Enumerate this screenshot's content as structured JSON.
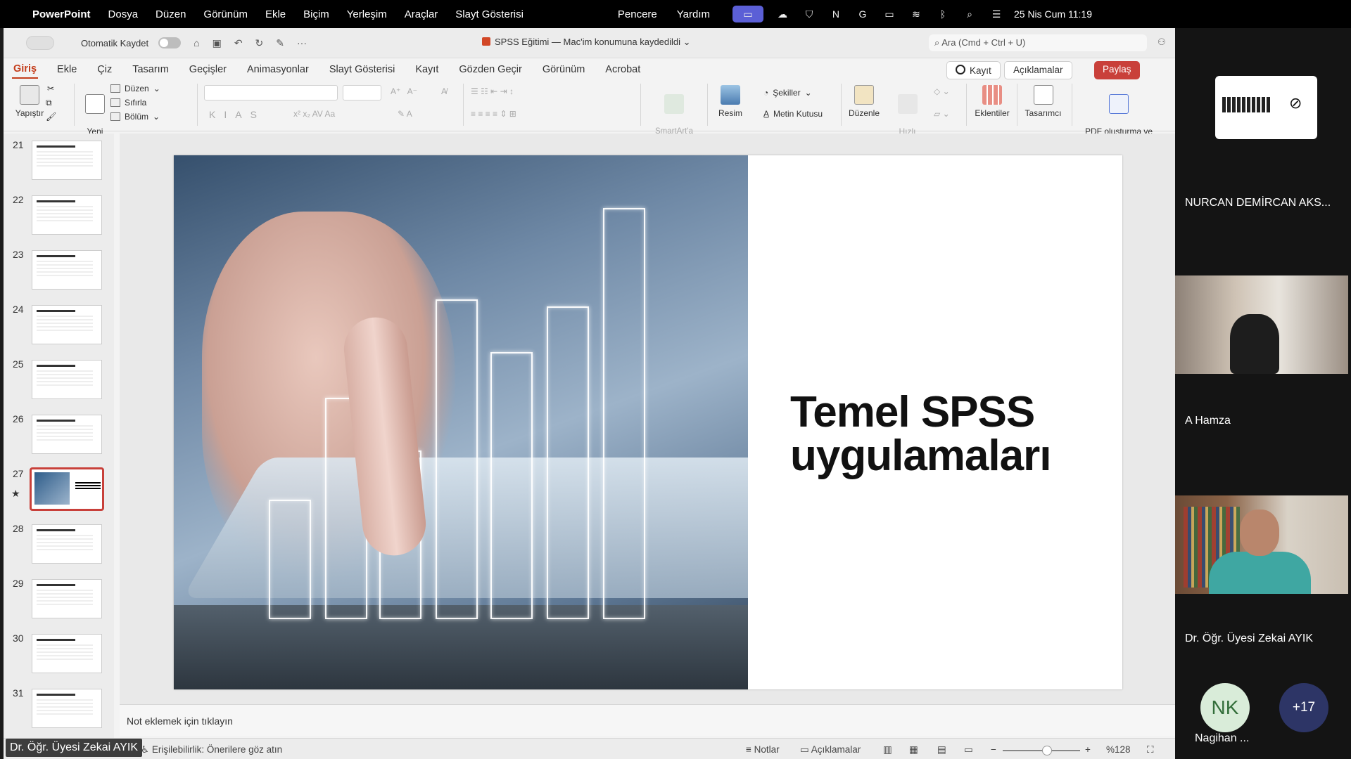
{
  "menubar": {
    "app": "PowerPoint",
    "items": [
      "Dosya",
      "Düzen",
      "Görünüm",
      "Ekle",
      "Biçim",
      "Yerleşim",
      "Araçlar",
      "Slayt Gösterisi"
    ],
    "right_items": [
      "Pencere",
      "Yardım"
    ],
    "clock": "25 Nis Cum  11:19"
  },
  "titlebar": {
    "autosave": "Otomatik Kaydet",
    "document": "SPSS Eğitimi — Mac'im konumuna kaydedildi",
    "search_placeholder": "Ara (Cmd + Ctrl + U)"
  },
  "tabs": [
    "Giriş",
    "Ekle",
    "Çiz",
    "Tasarım",
    "Geçişler",
    "Animasyonlar",
    "Slayt Gösterisi",
    "Kayıt",
    "Gözden Geçir",
    "Görünüm",
    "Acrobat"
  ],
  "tab_buttons": {
    "record": "Kayıt",
    "comments": "Açıklamalar",
    "share": "Paylaş"
  },
  "ribbon": {
    "paste": "Yapıştır",
    "new_slide": "Yeni\nSlayt",
    "layout": "Düzen",
    "reset": "Sıfırla",
    "section": "Bölüm",
    "smartart": "SmartArt'a\nDönüştür",
    "picture": "Resim",
    "shapes": "Şekiller",
    "textbox": "Metin Kutusu",
    "arrange": "Düzenle",
    "quick_styles": "Hızlı\nStiller",
    "addins": "Eklentiler",
    "designer": "Tasarımcı",
    "pdf": "PDF oluşturma ve\nbağlantı paylaşma"
  },
  "thumbnails": [
    "21",
    "22",
    "23",
    "24",
    "25",
    "26",
    "27",
    "28",
    "29",
    "30",
    "31"
  ],
  "selected_thumbnail": "27",
  "slide": {
    "title_line1": "Temel SPSS",
    "title_line2": "uygulamaları"
  },
  "notes_placeholder": "Not eklemek için tıklayın",
  "statusbar": {
    "accessibility": "Erişilebilirlik: Önerilere göz atın",
    "notes": "Notlar",
    "comments": "Açıklamalar",
    "zoom": "%128"
  },
  "speaker_label": "Dr. Öğr. Üyesi  Zekai AYIK",
  "participants": [
    {
      "name": "NURCAN DEMİRCAN AKS..."
    },
    {
      "name": "A Hamza"
    },
    {
      "name": "Dr. Öğr. Üyesi  Zekai AYIK"
    },
    {
      "initials": "NK",
      "name": "Nagihan ..."
    }
  ],
  "more_participants": "+17",
  "colors": {
    "accent": "#c43e1c",
    "share": "#c9403a",
    "menubar_highlight": "#5b5fd6"
  }
}
